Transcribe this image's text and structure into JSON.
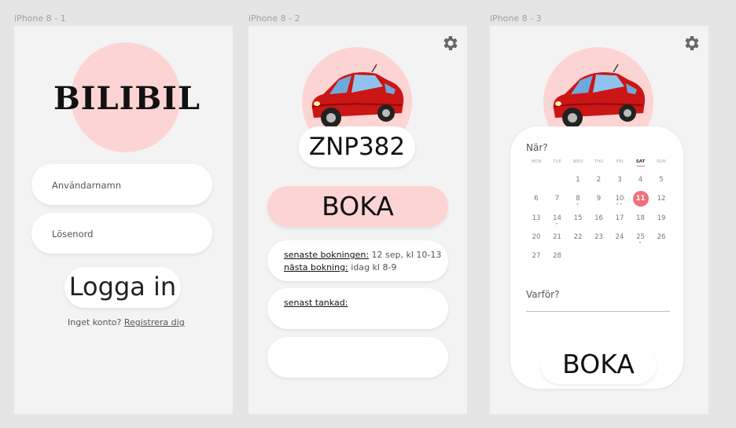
{
  "frames": [
    {
      "label": "iPhone 8 - 1"
    },
    {
      "label": "iPhone 8 - 2"
    },
    {
      "label": "iPhone 8 - 3"
    }
  ],
  "login": {
    "logo": "BILIBIL",
    "username_placeholder": "Användarnamn",
    "password_placeholder": "Lösenord",
    "login_button": "Logga in",
    "no_account": "Inget konto?",
    "register_link": "Registrera dig"
  },
  "home": {
    "plate": "ZNP382",
    "book_button": "BOKA",
    "last_booking_label": "senaste bokningen:",
    "last_booking_value": "12 sep, kl 10-13",
    "next_booking_label": "nästa bokning:",
    "next_booking_value": "idag kl 8-9",
    "last_fuel_label": "senast tankad:"
  },
  "booking": {
    "when_label": "När?",
    "weekdays": [
      "MON",
      "TUE",
      "WED",
      "THU",
      "FRI",
      "SAT",
      "SUN"
    ],
    "selected_weekday_index": 5,
    "weeks": [
      [
        "",
        "",
        "1",
        "2",
        "3",
        "4",
        "5"
      ],
      [
        "6",
        "7",
        "8",
        "9",
        "10",
        "11",
        "12"
      ],
      [
        "13",
        "14",
        "15",
        "16",
        "17",
        "18",
        "19"
      ],
      [
        "20",
        "21",
        "22",
        "23",
        "24",
        "25",
        "26"
      ],
      [
        "27",
        "28",
        "",
        "",
        "",
        "",
        ""
      ]
    ],
    "selected_day": "11",
    "event_dots": {
      "8": "•",
      "10": "••",
      "14": "•",
      "25": "•"
    },
    "why_label": "Varför?",
    "book_button": "BOKA"
  },
  "colors": {
    "accent_pink": "#fdd4d4",
    "selected_day": "#f06f7b",
    "car_red": "#cc1515"
  }
}
